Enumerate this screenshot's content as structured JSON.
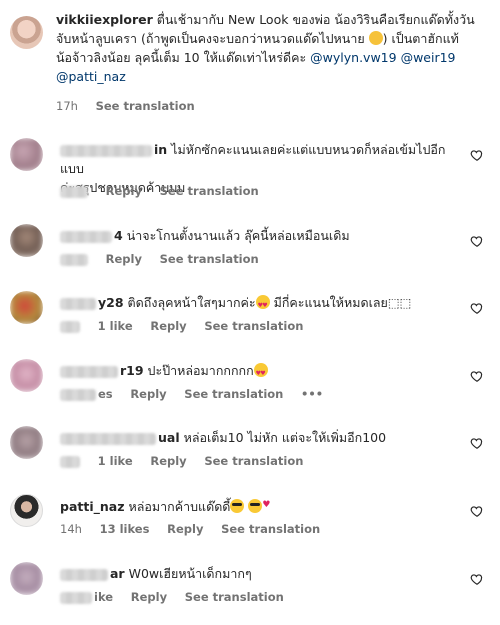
{
  "caption": {
    "username": "vikkiiexplorer",
    "line1": "ตื่นเช้ามากับ New Look ของพ่อ น้องวิรินคือเรียกแด๊ดทั้งวัน",
    "line2": "จับหน้าลูบเครา (ถ้าพูดเป็นคงจะบอกว่าหนวดแด๊ดไปหนาย",
    "line2b": ") เป็นตาฮักแท้",
    "line3": "น้อจ้าวลิงน้อย ลุคนี้เต็ม 10 ให้แด๊ดเท่าไหร่ดีคะ",
    "mentions": [
      "@wylyn.vw19",
      "@weir19",
      "@patti_naz"
    ],
    "time": "17h",
    "see_translation": "See translation"
  },
  "comments": [
    {
      "username_visible": "in",
      "text": "ไม่หักซักคะแนนเลยค่ะแต่แบบหนวดก็หล่อเข้มไปอีกแบบ",
      "text2": "ค่ะสรุปชอบหมดค้าบบบ",
      "time": "",
      "likes": "",
      "reply": "Reply",
      "see_translation": "See translation"
    },
    {
      "username_visible": "4",
      "text": "น่าจะโกนตั้งนานแล้ว ลุ๊คนี้หล่อเหมือนเดิม",
      "time": "",
      "likes": "",
      "reply": "Reply",
      "see_translation": "See translation"
    },
    {
      "username_visible": "y28",
      "text": "ติดถึงลุคหน้าใสๆมากค่ะ",
      "text_after": "มีกี่คะแนนให้หมดเลย⬚⬚",
      "time": "",
      "likes": "1 like",
      "reply": "Reply",
      "see_translation": "See translation"
    },
    {
      "username_visible": "r19",
      "text": "ปะป๊าหล่อมากกกกก",
      "time": "",
      "likes": "es",
      "reply": "Reply",
      "see_translation": "See translation",
      "more": "•••"
    },
    {
      "username_visible": "ual",
      "text": "หล่อเต็ม10 ไม่หัก แต่จะให้เพิ่มอีก100",
      "time": "",
      "likes": "1 like",
      "reply": "Reply",
      "see_translation": "See translation"
    },
    {
      "username_visible": "patti_naz",
      "text": "หล่อมากค้าบแด๊ดดี้",
      "time": "14h",
      "likes": "13 likes",
      "reply": "Reply",
      "see_translation": "See translation"
    },
    {
      "username_visible": "ar",
      "text": "W0wเฮียหน้าเด็กมากๆ",
      "time": "",
      "likes": "ike",
      "reply": "Reply",
      "see_translation": "See translation"
    }
  ],
  "icons": {
    "like": "heart-outline-icon",
    "emoji_grin": "grinning-emoji-icon",
    "emoji_love": "heart-eyes-emoji-icon",
    "emoji_cool": "sunglasses-emoji-icon"
  },
  "colors": {
    "text": "#262626",
    "meta": "#737373",
    "mention": "#00376b"
  }
}
